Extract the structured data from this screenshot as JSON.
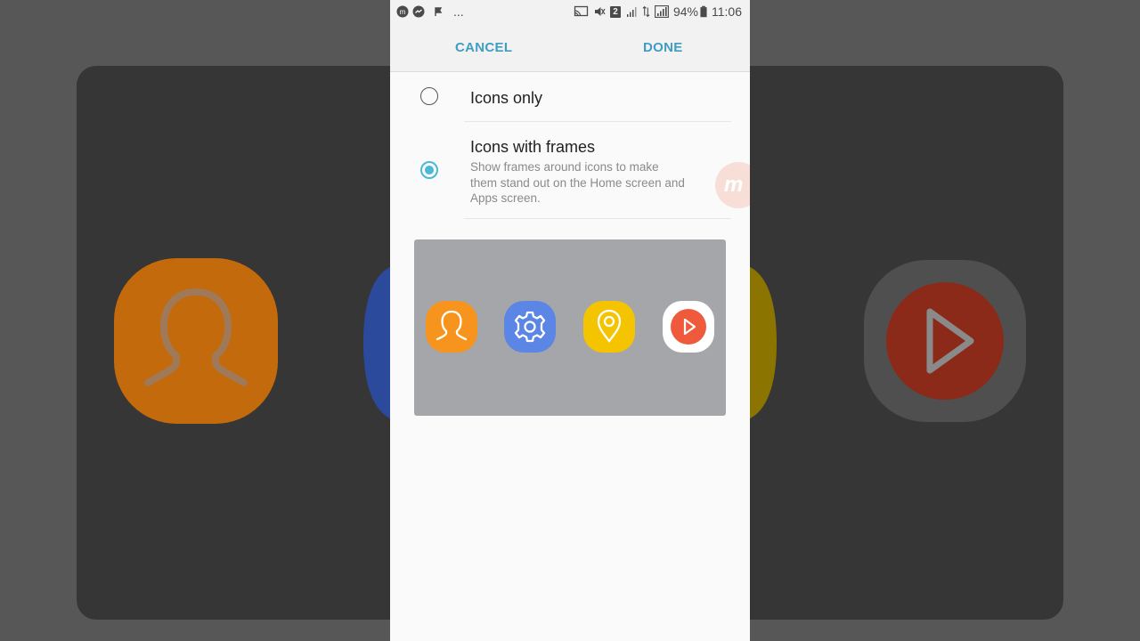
{
  "status_bar": {
    "notification_icons": [
      "messenger-m-icon",
      "messenger-icon",
      "flag-icon"
    ],
    "overflow": "...",
    "system_icons": [
      "cast-icon",
      "mute-icon",
      "sim-2-icon",
      "signal-icon",
      "data-arrows-icon",
      "signal-full-icon",
      "battery-icon"
    ],
    "sim_badge": "2",
    "battery": "94%",
    "time": "11:06"
  },
  "action_bar": {
    "cancel_label": "CANCEL",
    "done_label": "DONE"
  },
  "options": [
    {
      "title": "Icons only",
      "selected": false
    },
    {
      "title": "Icons with frames",
      "selected": true,
      "description": "Show frames around icons to make them stand out on the Home screen and Apps screen."
    }
  ],
  "watermark": {
    "text": "m"
  },
  "preview_icons": [
    {
      "name": "contacts-icon",
      "color": "#f7941d"
    },
    {
      "name": "settings-icon",
      "color": "#5b86e5"
    },
    {
      "name": "location-pin-icon",
      "color": "#f5c400"
    },
    {
      "name": "video-play-icon",
      "color": "#ef5a3c"
    }
  ],
  "colors": {
    "accent": "#3f9dc3",
    "radio_selected": "#49b8d9"
  }
}
